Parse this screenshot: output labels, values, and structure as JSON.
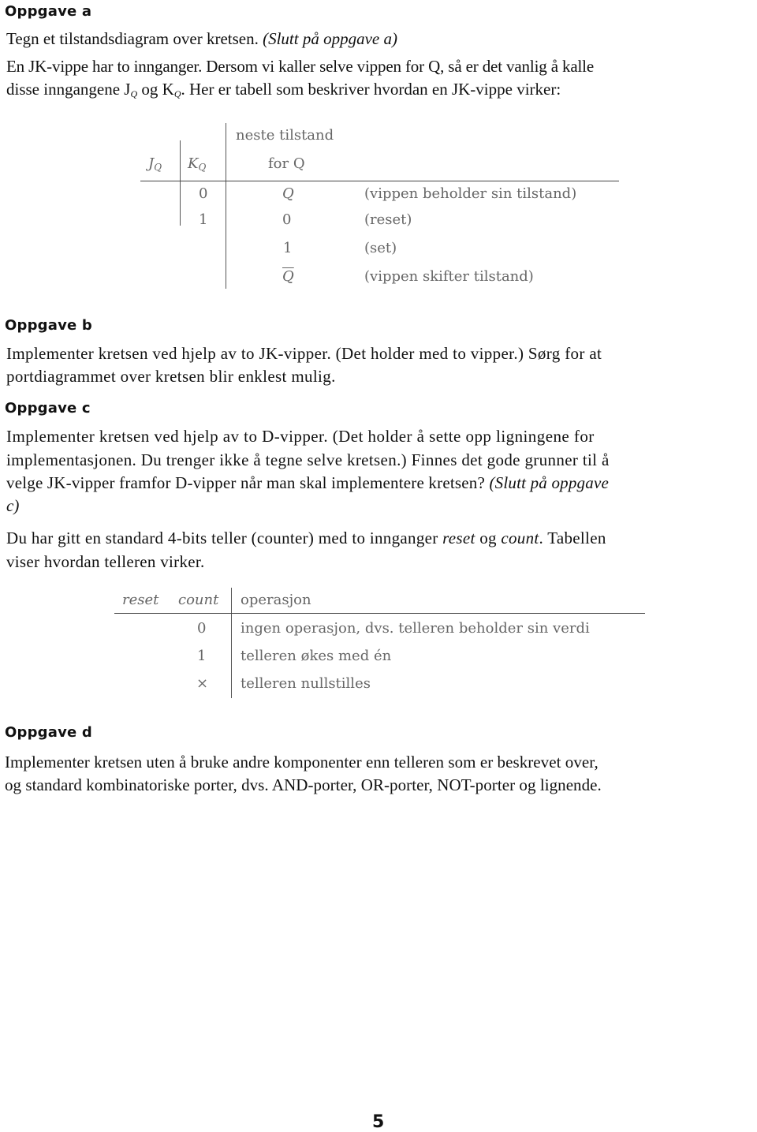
{
  "sections": {
    "a": {
      "heading": "Oppgave a",
      "line1_plain": "Tegn et tilstandsdiagram over kretsen. ",
      "line1_italic": "(Slutt på oppgave a)",
      "intro_line1": "En JK-vippe har to innganger. Dersom vi kaller selve vippen for Q, så er det vanlig å kalle",
      "intro_line2_a": "disse inngangene J",
      "intro_line2_sub1": "Q",
      "intro_line2_b": " og K",
      "intro_line2_sub2": "Q",
      "intro_line2_c": ". Her er tabell som beskriver hvordan en JK-vippe virker:"
    },
    "jk_table": {
      "header_top": "neste tilstand",
      "col_j": "J",
      "col_j_sub": "Q",
      "col_k": "K",
      "col_k_sub": "Q",
      "col_next": "for Q",
      "rows": [
        {
          "k": "0",
          "next": "Q",
          "next_overline": false,
          "desc": "(vippen beholder sin tilstand)"
        },
        {
          "k": "1",
          "next": "0",
          "next_overline": false,
          "desc": "(reset)"
        },
        {
          "k": "",
          "next": "1",
          "next_overline": false,
          "desc": "(set)"
        },
        {
          "k": "",
          "next": "Q",
          "next_overline": true,
          "desc": "(vippen skifter tilstand)"
        }
      ]
    },
    "b": {
      "heading": "Oppgave b",
      "line1": "Implementer kretsen ved hjelp av to JK-vipper. (Det holder med to vipper.) Sørg for at",
      "line2": "portdiagrammet over kretsen blir enklest mulig."
    },
    "c": {
      "heading": "Oppgave c",
      "line1": "Implementer kretsen ved hjelp av to D-vipper. (Det holder å sette opp ligningene for",
      "line2": "implementasjonen. Du trenger ikke å tegne selve kretsen.) Finnes det gode grunner til å",
      "line3_plain": "velge JK-vipper framfor D-vipper når man skal implementere kretsen? ",
      "line3_italic": "(Slutt på oppgave",
      "line4_italic": "c)"
    },
    "counter_intro": {
      "line1_a": "Du har gitt en standard 4-bits teller (counter) med to innganger ",
      "line1_reset": "reset",
      "line1_og": " og ",
      "line1_count": "count",
      "line1_b": ". Tabellen",
      "line2": "viser hvordan telleren virker."
    },
    "counter_table": {
      "col_reset": "reset",
      "col_count": "count",
      "col_op": "operasjon",
      "rows": [
        {
          "count": "0",
          "op": "ingen operasjon, dvs. telleren beholder sin verdi"
        },
        {
          "count": "1",
          "op": "telleren økes med én"
        },
        {
          "count": "×",
          "op": "telleren nullstilles"
        }
      ]
    },
    "d": {
      "heading": "Oppgave d",
      "line1": "Implementer kretsen uten å bruke andre komponenter enn telleren som er beskrevet over,",
      "line2": "og standard kombinatoriske porter, dvs. AND-porter, OR-porter, NOT-porter og lignende."
    }
  },
  "page_number": "5"
}
